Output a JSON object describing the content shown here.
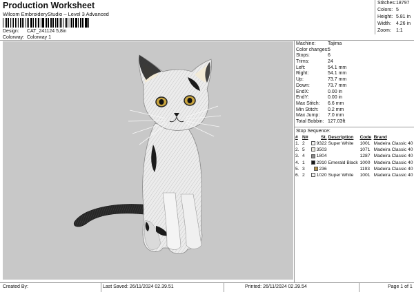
{
  "header": {
    "title": "Production Worksheet",
    "subtitle": "Wilcom EmbroideryStudio – Level 3 Advanced",
    "design_label": "Design:",
    "design_value": "CAT_241124 5,8in",
    "colorway_label": "Colorway:",
    "colorway_value": "Colorway 1"
  },
  "stats": [
    {
      "label": "Stitches:",
      "value": "18797"
    },
    {
      "label": "Colors:",
      "value": "5"
    },
    {
      "label": "Height:",
      "value": "5.81 in"
    },
    {
      "label": "Width:",
      "value": "4.26 in"
    },
    {
      "label": "Zoom:",
      "value": "1:1"
    }
  ],
  "machine_props": [
    {
      "label": "Machine:",
      "value": "Tajima"
    },
    {
      "label": "Color changes:",
      "value": "5"
    },
    {
      "label": "Stops:",
      "value": "6"
    },
    {
      "label": "Trims:",
      "value": "24"
    },
    {
      "label": "Left:",
      "value": "54.1 mm"
    },
    {
      "label": "Right:",
      "value": "54.1 mm"
    },
    {
      "label": "Up:",
      "value": "73.7 mm"
    },
    {
      "label": "Down:",
      "value": "73.7 mm"
    },
    {
      "label": "EndX:",
      "value": "0.00 in"
    },
    {
      "label": "EndY:",
      "value": "0.00 in"
    },
    {
      "label": "Max Stitch:",
      "value": "6.6 mm"
    },
    {
      "label": "Min Stitch:",
      "value": "0.2 mm"
    },
    {
      "label": "Max Jump:",
      "value": "7.0 mm"
    },
    {
      "label": "Total Bobbin:",
      "value": "127.03ft"
    }
  ],
  "stop_sequence": {
    "title": "Stop Sequence:",
    "columns": [
      "#",
      "N#",
      "St.",
      "Description",
      "Code",
      "Brand"
    ],
    "rows": [
      {
        "num": "1.",
        "n": "2",
        "color": "#f4f4f4",
        "st": "9322",
        "desc": "Super White",
        "code": "1001",
        "brand": "Madeira Classic 40"
      },
      {
        "num": "2.",
        "n": "5",
        "color": "#ece9df",
        "st": "3503",
        "desc": "",
        "code": "1071",
        "brand": "Madeira Classic 40"
      },
      {
        "num": "3.",
        "n": "4",
        "color": "#8a8a8a",
        "st": "1804",
        "desc": "",
        "code": "1287",
        "brand": "Madeira Classic 40"
      },
      {
        "num": "4.",
        "n": "1",
        "color": "#1b1b1b",
        "st": "2910",
        "desc": "Emerald Black",
        "code": "1000",
        "brand": "Madeira Classic 40"
      },
      {
        "num": "5.",
        "n": "3",
        "color": "#b5924a",
        "st": "236",
        "desc": "",
        "code": "1193",
        "brand": "Madeira Classic 40"
      },
      {
        "num": "6.",
        "n": "2",
        "color": "#f4f4f4",
        "st": "1020",
        "desc": "Super White",
        "code": "1001",
        "brand": "Madeira Classic 40"
      }
    ]
  },
  "footer": {
    "created_by": "Created By:",
    "last_saved": "Last Saved: 26/11/2024 02.39.51",
    "printed": "Printed: 26/11/2024 02.39.54",
    "page": "Page 1 of 1"
  },
  "colors": {
    "canvas_bg": "#c8c8c8",
    "cat_white": "#eaeaea",
    "cat_black": "#1b1b1b",
    "eye": "#c9a53f"
  }
}
